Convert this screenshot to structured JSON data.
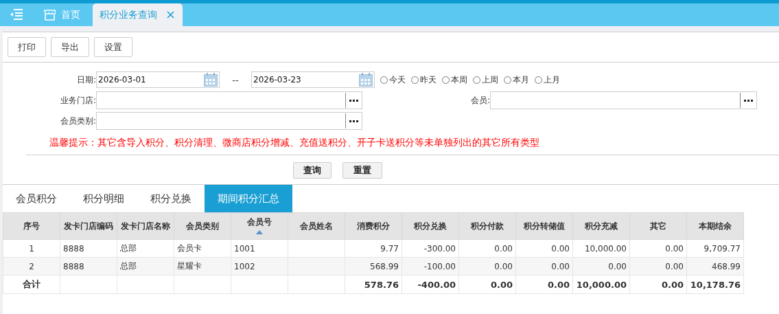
{
  "nav_tabs": [
    {
      "label": "首页",
      "selected": false,
      "closable": false
    },
    {
      "label": "积分业务查询",
      "selected": true,
      "closable": true
    }
  ],
  "toolbar": [
    "打印",
    "导出",
    "设置"
  ],
  "form": {
    "date_label": "日期:",
    "date_from": "2026-03-01",
    "date_separator": "--",
    "date_to": "2026-03-23",
    "quick_ranges": [
      {
        "label": "今天",
        "selected": false
      },
      {
        "label": "昨天",
        "selected": false
      },
      {
        "label": "本周",
        "selected": false
      },
      {
        "label": "上周",
        "selected": false
      },
      {
        "label": "本月",
        "selected": false
      },
      {
        "label": "上月",
        "selected": false
      }
    ],
    "store_label": "业务门店:",
    "member_label": "会员:",
    "member_type_label": "会员类别:",
    "warning": "温馨提示：其它含导入积分、积分清理、微商店积分增减、充值送积分、开子卡送积分等未单独列出的其它所有类型",
    "actions": [
      "查询",
      "重置"
    ]
  },
  "result_tabs": [
    {
      "label": "会员积分",
      "selected": false
    },
    {
      "label": "积分明细",
      "selected": false
    },
    {
      "label": "积分兑换",
      "selected": false
    },
    {
      "label": "期间积分汇总",
      "selected": true
    }
  ],
  "table": {
    "columns": [
      {
        "label": "序号",
        "sorted": false
      },
      {
        "label": "发卡门店编码",
        "sorted": false
      },
      {
        "label": "发卡门店名称",
        "sorted": false
      },
      {
        "label": "会员类别",
        "sorted": false
      },
      {
        "label": "会员号",
        "sorted": true
      },
      {
        "label": "会员姓名",
        "sorted": false
      },
      {
        "label": "消费积分",
        "sorted": false
      },
      {
        "label": "积分兑换",
        "sorted": false
      },
      {
        "label": "积分付款",
        "sorted": false
      },
      {
        "label": "积分转储值",
        "sorted": false
      },
      {
        "label": "积分充减",
        "sorted": false
      },
      {
        "label": "其它",
        "sorted": false
      },
      {
        "label": "本期结余",
        "sorted": false
      }
    ],
    "rows": [
      [
        "1",
        "8888",
        "总部",
        "会员卡",
        "1001",
        null,
        "9.77",
        "-300.00",
        "0.00",
        "0.00",
        "10,000.00",
        "0.00",
        "9,709.77"
      ],
      [
        "2",
        "8888",
        "总部",
        "星耀卡",
        "1002",
        null,
        "568.99",
        "-100.00",
        "0.00",
        "0.00",
        "0.00",
        "0.00",
        "468.99"
      ]
    ],
    "totals": {
      "label": "合计",
      "values": [
        "578.76",
        "-400.00",
        "0.00",
        "0.00",
        "10,000.00",
        "0.00",
        "10,178.76"
      ]
    }
  }
}
